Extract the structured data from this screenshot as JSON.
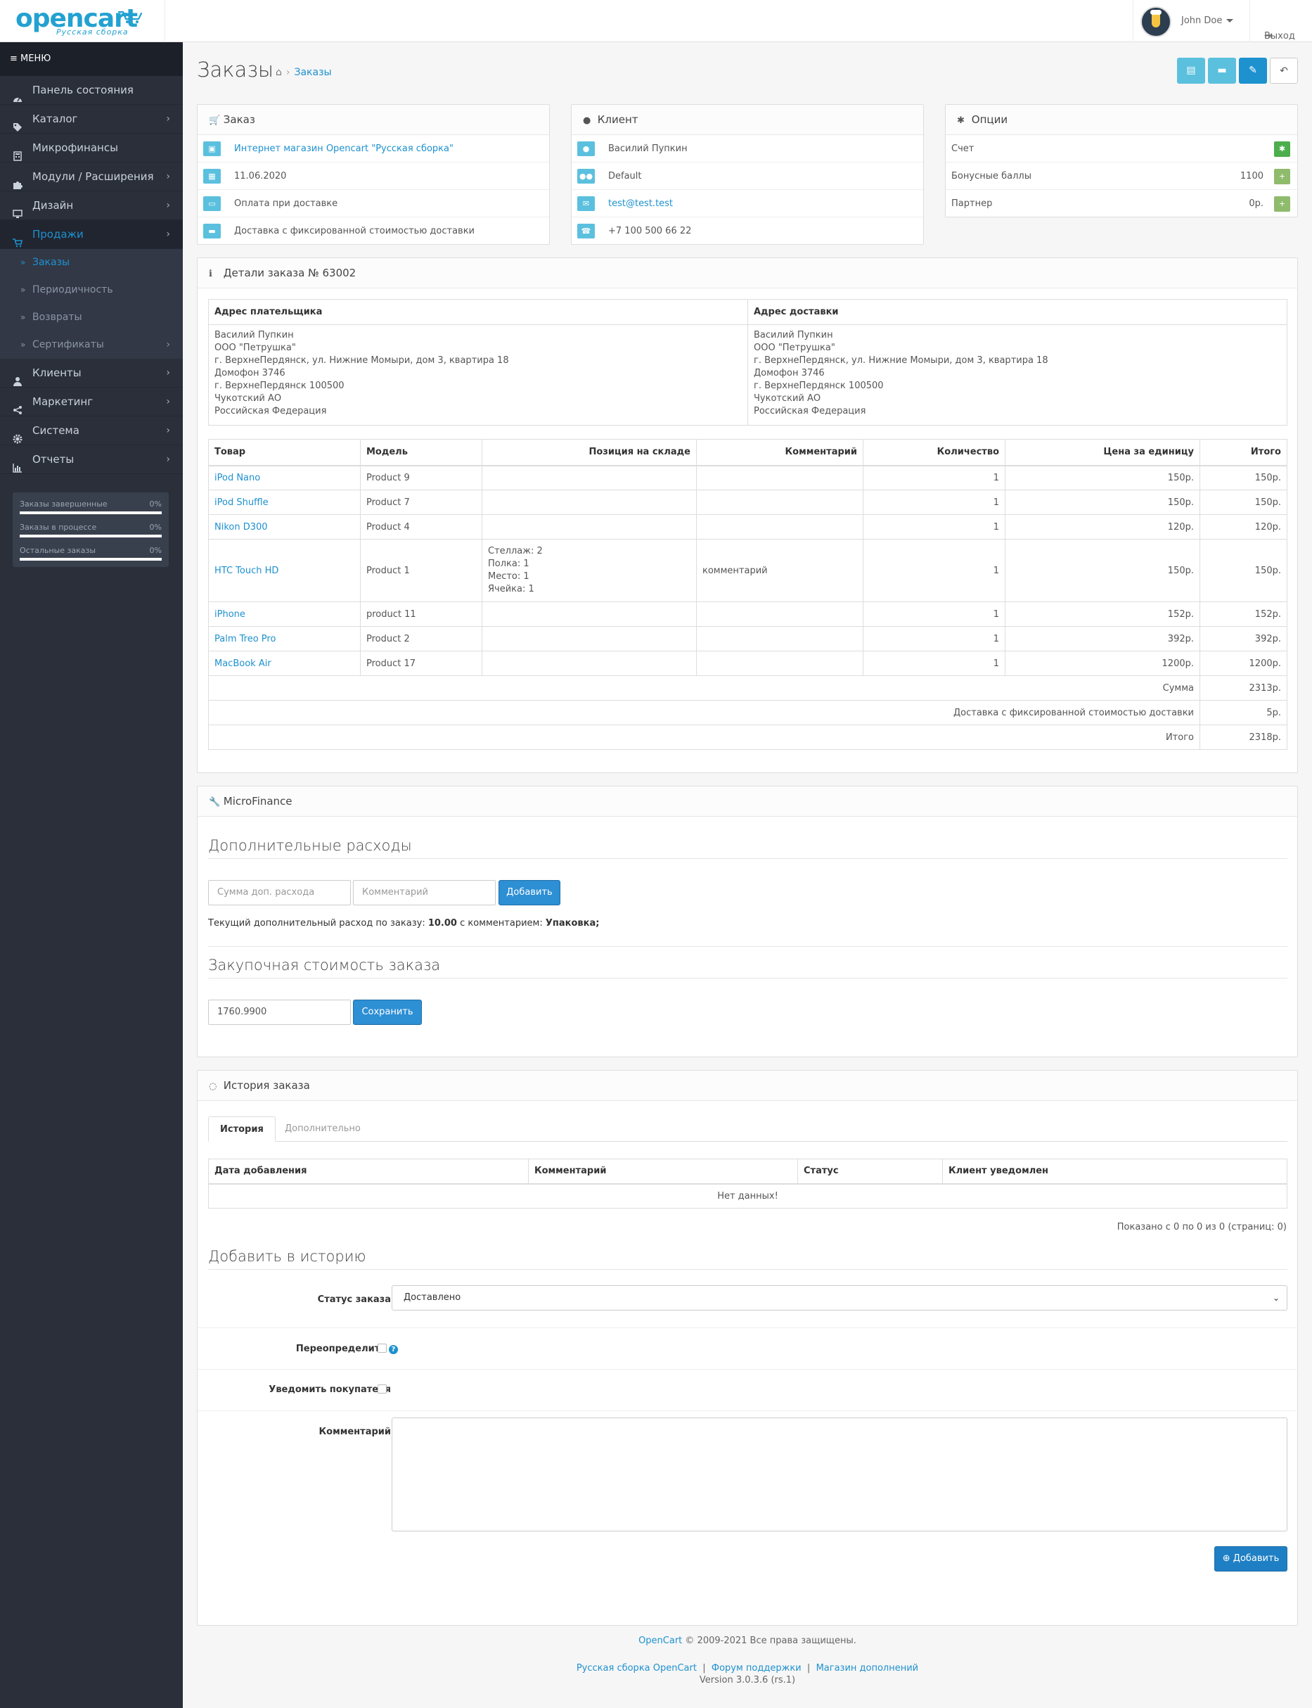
{
  "logo": {
    "word": "opencart",
    "subtitle": "Русская сборка"
  },
  "header": {
    "user_name": "John Doe",
    "logout_label": "Выход"
  },
  "sidebar": {
    "menu_label": "МЕНЮ",
    "items": [
      {
        "label": "Панель состояния",
        "icon": "dashboard-icon",
        "chevron": false
      },
      {
        "label": "Каталог",
        "icon": "tags-icon",
        "chevron": true
      },
      {
        "label": "Микрофинансы",
        "icon": "calculator-icon",
        "chevron": false
      },
      {
        "label": "Модули / Расширения",
        "icon": "puzzle-icon",
        "chevron": true
      },
      {
        "label": "Дизайн",
        "icon": "monitor-icon",
        "chevron": true
      },
      {
        "label": "Продажи",
        "icon": "cart-icon",
        "chevron": true
      }
    ],
    "sales_sub": [
      {
        "label": "Заказы"
      },
      {
        "label": "Периодичность"
      },
      {
        "label": "Возвраты"
      },
      {
        "label": "Сертификаты"
      }
    ],
    "items_after": [
      {
        "label": "Клиенты",
        "icon": "user-icon"
      },
      {
        "label": "Маркетинг",
        "icon": "share-icon"
      },
      {
        "label": "Система",
        "icon": "cog-icon"
      },
      {
        "label": "Отчеты",
        "icon": "bar-chart-icon"
      }
    ],
    "progress": [
      {
        "label": "Заказы завершенные",
        "value": "0%",
        "fraction": 0
      },
      {
        "label": "Заказы в процессе",
        "value": "0%",
        "fraction": 0
      },
      {
        "label": "Остальные заказы",
        "value": "0%",
        "fraction": 0
      }
    ]
  },
  "page": {
    "title": "Заказы",
    "breadcrumb": "Заказы"
  },
  "order_panel": {
    "title": "Заказ",
    "rows": [
      {
        "icon": "cart-icon",
        "text": "Интернет магазин Opencart \"Русская сборка\"",
        "link": true
      },
      {
        "icon": "calendar-icon",
        "text": "11.06.2020",
        "link": false
      },
      {
        "icon": "credit-card-icon",
        "text": "Оплата при доставке",
        "link": false
      },
      {
        "icon": "truck-icon",
        "text": "Доставка с фиксированной стоимостью доставки",
        "link": false
      }
    ]
  },
  "client_panel": {
    "title": "Клиент",
    "rows": [
      {
        "icon": "user-icon",
        "text": "Василий Пупкин",
        "link": false
      },
      {
        "icon": "group-icon",
        "text": "Default",
        "link": false
      },
      {
        "icon": "envelope-icon",
        "text": "test@test.test",
        "link": true
      },
      {
        "icon": "phone-icon",
        "text": "+7 100 500 66 22",
        "link": false
      }
    ]
  },
  "options_panel": {
    "title": "Опции",
    "rows": [
      {
        "label": "Счет",
        "value": ""
      },
      {
        "label": "Бонусные баллы",
        "value": "1100"
      },
      {
        "label": "Партнер",
        "value": "0р."
      }
    ]
  },
  "details": {
    "title": "Детали заказа № 63002",
    "payment_header": "Адрес плательщика",
    "shipping_header": "Адрес доставки",
    "payment_address": [
      "Василий Пупкин",
      "ООО \"Петрушка\"",
      "г. ВерхнеПердянск, ул. Нижние Момыри, дом 3, квартира 18",
      "Домофон 3746",
      "г. ВерхнеПердянск 100500",
      "Чукотский АО",
      "Российская Федерация"
    ],
    "shipping_address": [
      "Василий Пупкин",
      "ООО \"Петрушка\"",
      "г. ВерхнеПердянск, ул. Нижние Момыри, дом 3, квартира 18",
      "Домофон 3746",
      "г. ВерхнеПердянск 100500",
      "Чукотский АО",
      "Российская Федерация"
    ],
    "columns": [
      "Товар",
      "Модель",
      "Позиция на складе",
      "Комментарий",
      "Количество",
      "Цена за единицу",
      "Итого"
    ],
    "products": [
      {
        "name": "iPod Nano",
        "model": "Product 9",
        "stock": [],
        "comment": "",
        "qty": "1",
        "price": "150р.",
        "total": "150р."
      },
      {
        "name": "iPod Shuffle",
        "model": "Product 7",
        "stock": [],
        "comment": "",
        "qty": "1",
        "price": "150р.",
        "total": "150р."
      },
      {
        "name": "Nikon D300",
        "model": "Product 4",
        "stock": [],
        "comment": "",
        "qty": "1",
        "price": "120р.",
        "total": "120р."
      },
      {
        "name": "HTC Touch HD",
        "model": "Product 1",
        "stock": [
          "Стеллаж: 2",
          "Полка: 1",
          "Место: 1",
          "Ячейка: 1"
        ],
        "comment": "комментарий",
        "qty": "1",
        "price": "150р.",
        "total": "150р."
      },
      {
        "name": "iPhone",
        "model": "product 11",
        "stock": [],
        "comment": "",
        "qty": "1",
        "price": "152р.",
        "total": "152р."
      },
      {
        "name": "Palm Treo Pro",
        "model": "Product 2",
        "stock": [],
        "comment": "",
        "qty": "1",
        "price": "392р.",
        "total": "392р."
      },
      {
        "name": "MacBook Air",
        "model": "Product 17",
        "stock": [],
        "comment": "",
        "qty": "1",
        "price": "1200р.",
        "total": "1200р."
      }
    ],
    "totals": [
      {
        "label": "Сумма",
        "value": "2313р."
      },
      {
        "label": "Доставка с фиксированной стоимостью доставки",
        "value": "5р."
      },
      {
        "label": "Итого",
        "value": "2318р."
      }
    ]
  },
  "microfinance": {
    "title": "MicroFinance",
    "extra_heading": "Дополнительные расходы",
    "amount_placeholder": "Сумма доп. расхода",
    "comment_placeholder": "Комментарий",
    "add_label": "Добавить",
    "current_prefix": "Текущий дополнительный расход по заказу:",
    "current_amount": "10.00",
    "current_middle": "с комментарием:",
    "current_comment": "Упаковка;",
    "purchase_heading": "Закупочная стоимость заказа",
    "purchase_value": "1760.9900",
    "save_label": "Сохранить"
  },
  "history": {
    "title": "История заказа",
    "tab_history": "История",
    "tab_extra": "Дополнительно",
    "columns": [
      "Дата добавления",
      "Комментарий",
      "Статус",
      "Клиент уведомлен"
    ],
    "empty": "Нет данных!",
    "pagination": "Показано с 0 по 0 из 0 (страниц: 0)",
    "add_heading": "Добавить в историю",
    "status_label": "Статус заказа",
    "status_value": "Доставлено",
    "override_label": "Переопределить",
    "notify_label": "Уведомить покупателя",
    "comment_label": "Комментарий",
    "add_button": "Добавить"
  },
  "footer": {
    "brand": "OpenCart",
    "copyright": "© 2009-2021 Все права защищены.",
    "links": [
      "Русская сборка OpenCart",
      "Форум поддержки",
      "Магазин дополнений"
    ],
    "version": "Version 3.0.3.6 (rs.1)"
  }
}
